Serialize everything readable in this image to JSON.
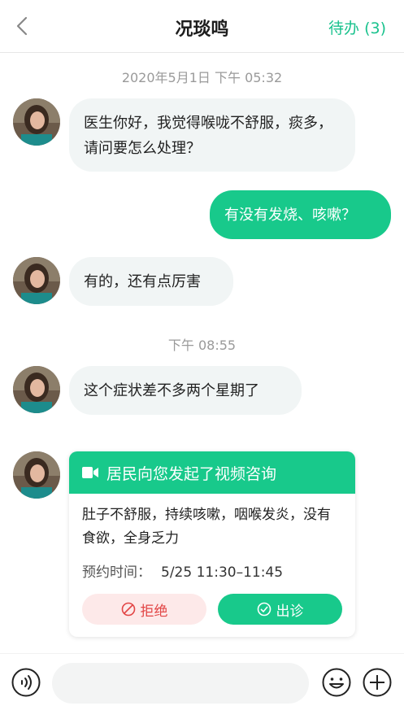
{
  "header": {
    "title": "况琰鸣",
    "todo_label": "待办 (3)"
  },
  "messages": [
    {
      "time": "2020年5月1日 下午 05:32"
    },
    {
      "text": "医生你好，我觉得喉咙不舒服，痰多，请问要怎么处理？"
    },
    {
      "text": "有没有发烧、咳嗽？"
    },
    {
      "text": "有的，还有点厉害"
    },
    {
      "time": "下午 08:55"
    },
    {
      "text": "这个症状差不多两个星期了"
    }
  ],
  "consult_card": {
    "title": "居民向您发起了视频咨询",
    "description": "肚子不舒服，持续咳嗽，咽喉发炎，没有食欲，全身乏力",
    "appointment_label": "预约时间：",
    "appointment_value": "5/25 11:30–11:45",
    "reject_label": "拒绝",
    "accept_label": "出诊"
  },
  "input_bar": {
    "placeholder": ""
  },
  "icons": [
    "back-chevron-icon",
    "video-icon",
    "reject-icon",
    "accept-check-icon",
    "voice-icon",
    "emoji-icon",
    "plus-icon"
  ],
  "colors": {
    "accent": "#18c98b",
    "reject": "#e24545",
    "bubble_in": "#f1f5f5"
  }
}
